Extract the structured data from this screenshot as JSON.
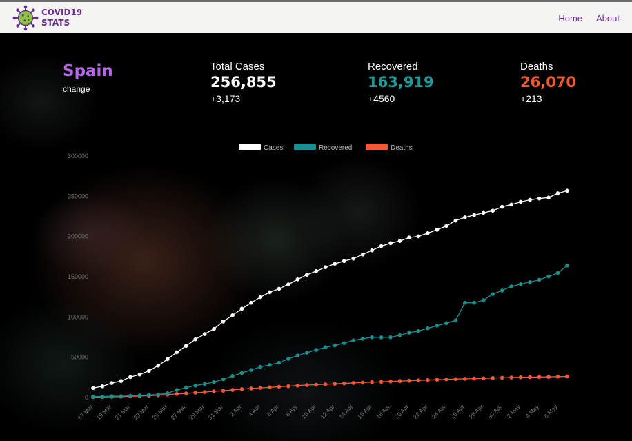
{
  "brand": {
    "line1": "COVID19",
    "line2": "STATS"
  },
  "nav": {
    "home": "Home",
    "about": "About"
  },
  "country": {
    "name": "Spain",
    "subtitle": "change"
  },
  "stats": {
    "total": {
      "label": "Total Cases",
      "value": "256,855",
      "delta": "+3,173"
    },
    "recovered": {
      "label": "Recovered",
      "value": "163,919",
      "delta": "+4560"
    },
    "deaths": {
      "label": "Deaths",
      "value": "26,070",
      "delta": "+213"
    }
  },
  "colors": {
    "brand": "#6a2c91",
    "country": "#b565e8",
    "cases": "#ffffff",
    "recovered": "#1a8f8f",
    "deaths": "#f4583a",
    "total_value": "#ffffff",
    "recovered_value": "#1c9a9a",
    "deaths_value": "#f15a31"
  },
  "icons": {
    "logo": "virus-icon"
  },
  "chart_data": {
    "type": "line",
    "x": [
      "17 Mar",
      "18 Mar",
      "19 Mar",
      "20 Mar",
      "21 Mar",
      "22 Mar",
      "23 Mar",
      "24 Mar",
      "25 Mar",
      "26 Mar",
      "27 Mar",
      "28 Mar",
      "29 Mar",
      "30 Mar",
      "31 Mar",
      "1 Apr",
      "2 Apr",
      "3 Apr",
      "4 Apr",
      "5 Apr",
      "6 Apr",
      "7 Apr",
      "8 Apr",
      "9 Apr",
      "10 Apr",
      "11 Apr",
      "12 Apr",
      "13 Apr",
      "14 Apr",
      "15 Apr",
      "16 Apr",
      "17 Apr",
      "18 Apr",
      "19 Apr",
      "20 Apr",
      "21 Apr",
      "22 Apr",
      "23 Apr",
      "24 Apr",
      "25 Apr",
      "26 Apr",
      "27 Apr",
      "28 Apr",
      "29 Apr",
      "30 Apr",
      "1 May",
      "2 May",
      "3 May",
      "4 May",
      "5 May",
      "6 May",
      "7 May"
    ],
    "tick_labels": [
      "17 Mar",
      "19 Mar",
      "21 Mar",
      "23 Mar",
      "25 Mar",
      "27 Mar",
      "29 Mar",
      "31 Mar",
      "2 Apr",
      "4 Apr",
      "6 Apr",
      "8 Apr",
      "10 Apr",
      "12 Apr",
      "14 Apr",
      "16 Apr",
      "18 Apr",
      "20 Apr",
      "22 Apr",
      "24 Apr",
      "26 Apr",
      "28 Apr",
      "30 Apr",
      "2 May",
      "4 May",
      "6 May"
    ],
    "series": [
      {
        "name": "Cases",
        "values": [
          11748,
          13910,
          17963,
          20410,
          25374,
          28572,
          33089,
          39673,
          47610,
          56188,
          64059,
          72248,
          78797,
          85195,
          94417,
          102136,
          110238,
          117710,
          124736,
          130759,
          135032,
          140510,
          146690,
          152446,
          157022,
          161852,
          166019,
          169496,
          172541,
          177633,
          182816,
          188068,
          191726,
          194416,
          198674,
          200210,
          204178,
          208389,
          213024,
          219764,
          223759,
          226629,
          229422,
          232128,
          236899,
          239639,
          242988,
          245567,
          247122,
          248301,
          253682,
          256855
        ]
      },
      {
        "name": "Recovered",
        "values": [
          1081,
          1107,
          1588,
          1588,
          2125,
          2575,
          3355,
          3794,
          5367,
          9357,
          12285,
          14709,
          16780,
          19259,
          22647,
          26743,
          30513,
          34219,
          38080,
          40437,
          43208,
          48021,
          52165,
          55668,
          59109,
          62391,
          64727,
          67504,
          70853,
          72963,
          74797,
          74662,
          74797,
          77357,
          80587,
          82514,
          85915,
          89250,
          92355,
          95708,
          117727,
          117727,
          120832,
          128511,
          132929,
          137984,
          140823,
          143374,
          146233,
          150376,
          154718,
          163919
        ]
      },
      {
        "name": "Deaths",
        "values": [
          533,
          623,
          830,
          1043,
          1375,
          1772,
          2311,
          2808,
          3647,
          4365,
          5138,
          5982,
          6803,
          7716,
          8464,
          9387,
          10348,
          11198,
          11947,
          12641,
          13341,
          14045,
          14792,
          15447,
          15843,
          16353,
          16972,
          17489,
          18056,
          18579,
          19130,
          19478,
          20002,
          20453,
          20852,
          21282,
          21717,
          22157,
          22524,
          22902,
          23190,
          23521,
          23822,
          24275,
          24543,
          24824,
          25100,
          25264,
          25428,
          25613,
          25857,
          26070
        ]
      }
    ],
    "ylim": [
      0,
      300000
    ],
    "yticks": [
      0,
      50000,
      100000,
      150000,
      200000,
      250000,
      300000
    ],
    "legend_position": "top",
    "grid": false
  }
}
